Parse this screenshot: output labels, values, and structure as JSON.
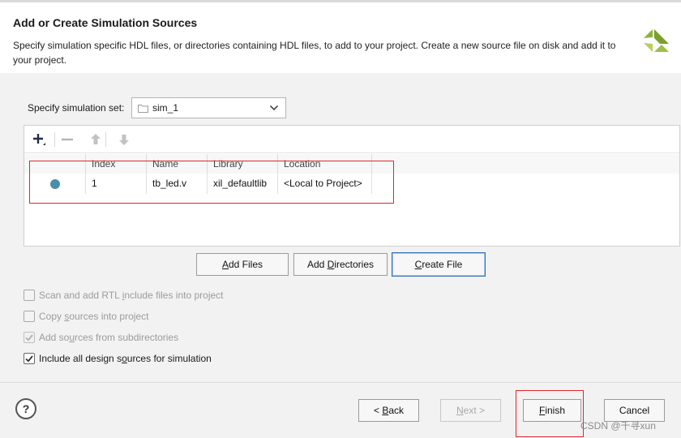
{
  "dialog": {
    "title": "Add or Create Simulation Sources",
    "description": "Specify simulation specific HDL files, or directories containing HDL files, to add to your project. Create a new source file on disk and add it to your project."
  },
  "simset": {
    "label": "Specify simulation set:",
    "value": "sim_1"
  },
  "table": {
    "columns": [
      "Index",
      "Name",
      "Library",
      "Location"
    ],
    "rows": [
      {
        "index": "1",
        "name": "tb_led.v",
        "library": "xil_defaultlib",
        "location": "<Local to Project>"
      }
    ]
  },
  "actions": {
    "add_files": {
      "pre": "",
      "key": "A",
      "post": "dd Files"
    },
    "add_directories": {
      "pre": "Add ",
      "key": "D",
      "post": "irectories"
    },
    "create_file": {
      "pre": "",
      "key": "C",
      "post": "reate File"
    }
  },
  "options": [
    {
      "pre": "Scan and add RTL ",
      "key": "i",
      "post": "nclude files into project",
      "checked": false,
      "enabled": false
    },
    {
      "pre": "Copy ",
      "key": "s",
      "post": "ources into project",
      "checked": false,
      "enabled": false
    },
    {
      "pre": "Add so",
      "key": "u",
      "post": "rces from subdirectories",
      "checked": true,
      "enabled": false
    },
    {
      "pre": "Include all design s",
      "key": "o",
      "post": "urces for simulation",
      "checked": true,
      "enabled": true
    }
  ],
  "footer": {
    "help": "?",
    "back": {
      "pre": "< ",
      "key": "B",
      "post": "ack"
    },
    "next": {
      "pre": "",
      "key": "N",
      "post": "ext >"
    },
    "finish": {
      "pre": "",
      "key": "F",
      "post": "inish"
    },
    "cancel": "Cancel"
  },
  "watermark": "CSDN @千寻xun",
  "colors": {
    "highlight_box": "#e0262c",
    "status_dot": "#4a8eaa",
    "focus_border": "#2f6fba"
  },
  "icons": [
    "xilinx-logo-icon",
    "folder-icon",
    "chevron-down-icon",
    "add-icon",
    "remove-icon",
    "move-up-icon",
    "move-down-icon",
    "checkmark-icon",
    "help-icon"
  ]
}
